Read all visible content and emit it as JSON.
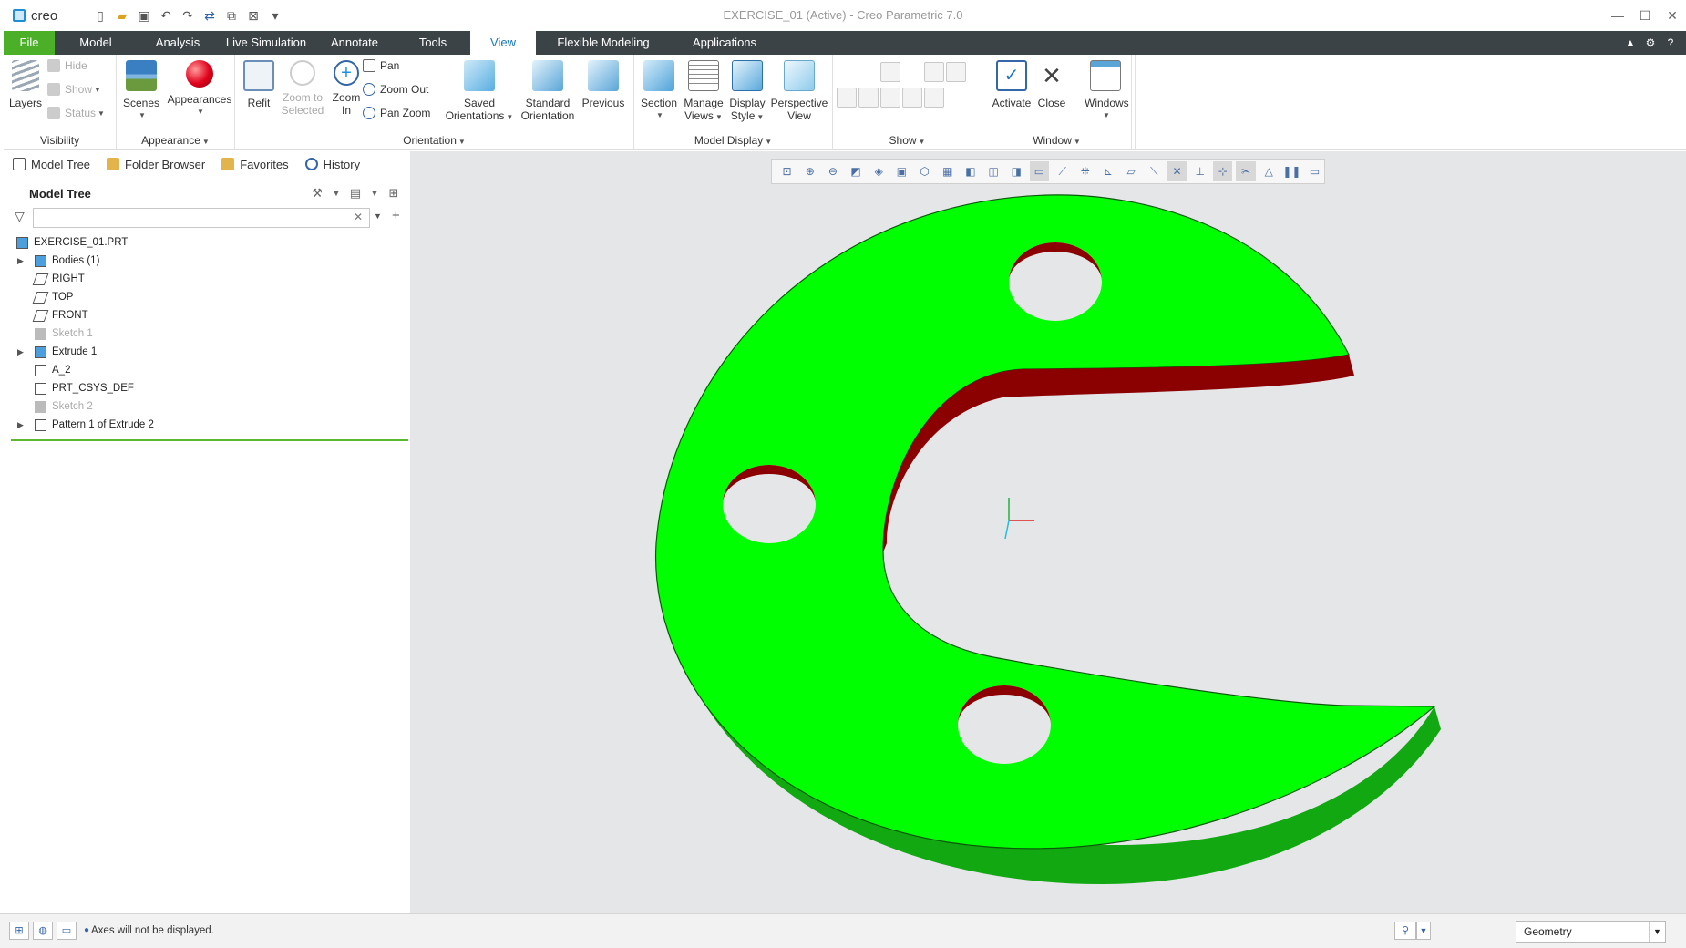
{
  "app": {
    "logo": "creo",
    "window_title": "EXERCISE_01 (Active) - Creo Parametric 7.0"
  },
  "tabs": [
    "File",
    "Model",
    "Analysis",
    "Live Simulation",
    "Annotate",
    "Tools",
    "View",
    "Flexible Modeling",
    "Applications"
  ],
  "active_tab": "View",
  "ribbon": {
    "visibility": {
      "label": "Visibility",
      "layers": "Layers",
      "hide": "Hide",
      "show": "Show",
      "status": "Status"
    },
    "appearance": {
      "label": "Appearance",
      "scenes": "Scenes",
      "appearances": "Appearances"
    },
    "orientation": {
      "label": "Orientation",
      "refit": "Refit",
      "zoom_to_selected_1": "Zoom to",
      "zoom_to_selected_2": "Selected",
      "zoom_in_1": "Zoom",
      "zoom_in_2": "In",
      "pan": "Pan",
      "zoom_out": "Zoom Out",
      "pan_zoom": "Pan Zoom",
      "saved_1": "Saved",
      "saved_2": "Orientations",
      "standard_1": "Standard",
      "standard_2": "Orientation",
      "previous": "Previous"
    },
    "model_display": {
      "label": "Model Display",
      "section": "Section",
      "manage_1": "Manage",
      "manage_2": "Views",
      "display_1": "Display",
      "display_2": "Style",
      "perspective_1": "Perspective",
      "perspective_2": "View"
    },
    "show": {
      "label": "Show"
    },
    "window": {
      "label": "Window",
      "activate": "Activate",
      "close": "Close",
      "windows": "Windows"
    }
  },
  "nav_tabs": [
    "Model Tree",
    "Folder Browser",
    "Favorites",
    "History"
  ],
  "model_tree": {
    "title": "Model Tree",
    "search_placeholder": "",
    "items": [
      {
        "label": "EXERCISE_01.PRT",
        "level": 0,
        "expandable": false,
        "dim": false,
        "icon": "part-icon"
      },
      {
        "label": "Bodies (1)",
        "level": 1,
        "expandable": true,
        "dim": false,
        "icon": "bodies-icon"
      },
      {
        "label": "RIGHT",
        "level": 1,
        "expandable": false,
        "dim": false,
        "icon": "datum-plane-icon"
      },
      {
        "label": "TOP",
        "level": 1,
        "expandable": false,
        "dim": false,
        "icon": "datum-plane-icon"
      },
      {
        "label": "FRONT",
        "level": 1,
        "expandable": false,
        "dim": false,
        "icon": "datum-plane-icon"
      },
      {
        "label": "Sketch 1",
        "level": 1,
        "expandable": false,
        "dim": true,
        "icon": "sketch-icon"
      },
      {
        "label": "Extrude 1",
        "level": 1,
        "expandable": true,
        "dim": false,
        "icon": "extrude-icon"
      },
      {
        "label": "A_2",
        "level": 1,
        "expandable": false,
        "dim": false,
        "icon": "axis-icon"
      },
      {
        "label": "PRT_CSYS_DEF",
        "level": 1,
        "expandable": false,
        "dim": false,
        "icon": "csys-icon"
      },
      {
        "label": "Sketch 2",
        "level": 1,
        "expandable": false,
        "dim": true,
        "icon": "sketch-icon"
      },
      {
        "label": "Pattern 1 of Extrude 2",
        "level": 1,
        "expandable": true,
        "dim": false,
        "icon": "pattern-icon"
      }
    ]
  },
  "status": {
    "message": "Axes will not be displayed.",
    "filter": "Geometry"
  },
  "colors": {
    "file_tab": "#4caf28",
    "tabbar": "#3c4346",
    "active_tab_text": "#1b77c4",
    "model_face": "#00ff00",
    "model_side": "#12a812",
    "model_inner": "#8b0000",
    "viewport_bg": "#e5e6e8"
  }
}
